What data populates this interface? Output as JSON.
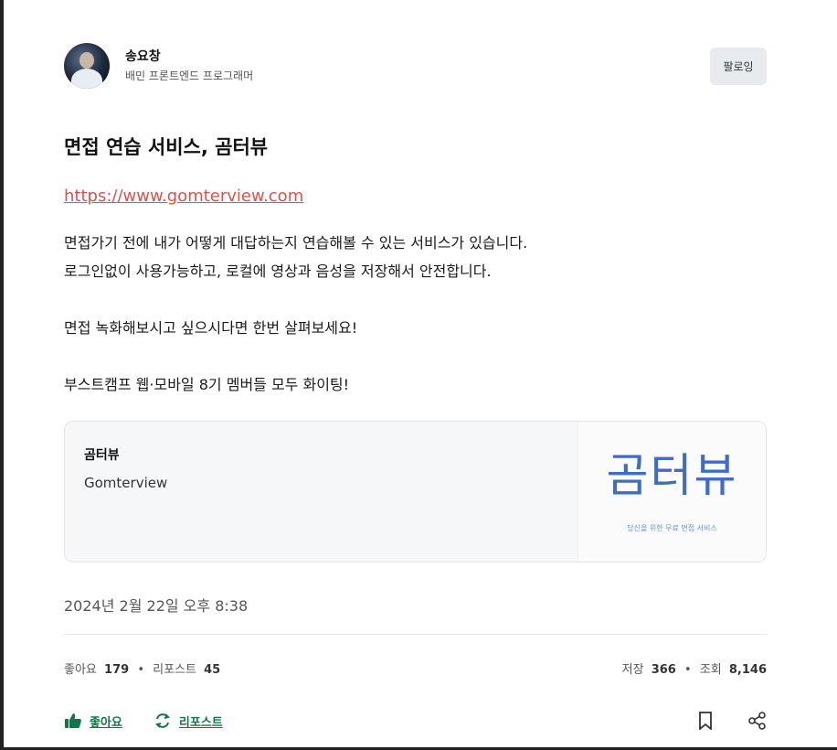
{
  "author": {
    "name": "송요창",
    "bio": "배민 프론트엔드 프로그래머",
    "follow_label": "팔로잉"
  },
  "post": {
    "title": "면접 연습 서비스, 곰터뷰",
    "link": "https://www.gomterview.com",
    "paragraphs": [
      "면접가기 전에 내가 어떻게 대답하는지 연습해볼 수 있는 서비스가 있습니다.",
      "로그인없이 사용가능하고, 로컬에 영상과 음성을 저장해서 안전합니다.",
      "면접 녹화해보시고 싶으시다면 한번 살펴보세요!",
      "부스트캠프 웹·모바일 8기 멤버들 모두 화이팅!"
    ],
    "date": "2024년 2월 22일 오후 8:38"
  },
  "link_card": {
    "title": "곰터뷰",
    "subtitle": "Gomterview",
    "logo_text": "곰터뷰",
    "logo_tagline": "당신을 위한 무료 면접 서비스"
  },
  "stats": {
    "likes_label": "좋아요",
    "likes": "179",
    "reposts_label": "리포스트",
    "reposts": "45",
    "saves_label": "저장",
    "saves": "366",
    "views_label": "조회",
    "views": "8,146",
    "separator": "•"
  },
  "actions": {
    "like_label": "좋아요",
    "repost_label": "리포스트"
  },
  "colors": {
    "accent_green": "#16744a",
    "link_red": "#d9534a",
    "logo_blue": "#3f6cc4"
  },
  "icons": [
    "thumbs-up-icon",
    "repost-icon",
    "bookmark-icon",
    "share-icon"
  ]
}
